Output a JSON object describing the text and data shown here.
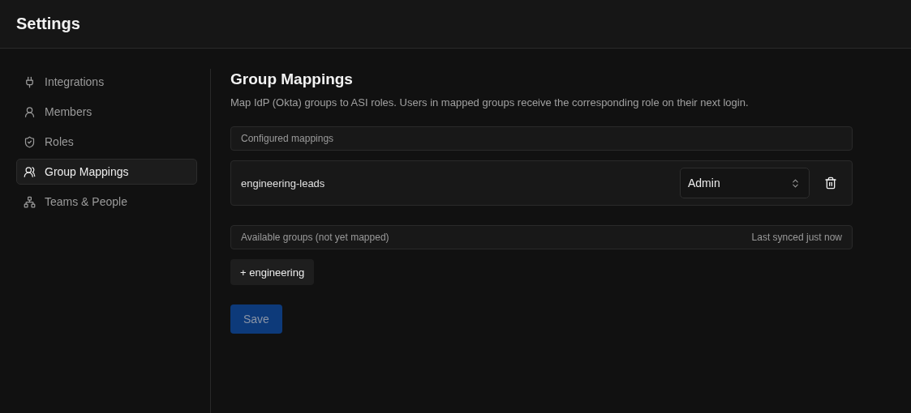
{
  "header": {
    "title": "Settings"
  },
  "sidebar": {
    "items": [
      {
        "label": "Integrations",
        "selected": false
      },
      {
        "label": "Members",
        "selected": false
      },
      {
        "label": "Roles",
        "selected": false
      },
      {
        "label": "Group Mappings",
        "selected": true
      },
      {
        "label": "Teams & People",
        "selected": false
      }
    ]
  },
  "main": {
    "title": "Group Mappings",
    "description": "Map IdP (Okta) groups to ASI roles. Users in mapped groups receive the corresponding role on their next login.",
    "configured": {
      "heading": "Configured mappings",
      "rows": [
        {
          "group": "engineering-leads",
          "role": "Admin"
        }
      ]
    },
    "available": {
      "heading": "Available groups (not yet mapped)",
      "sync_status": "Last synced just now",
      "groups": [
        "+ engineering"
      ]
    },
    "save_button": {
      "label": "Save",
      "disabled": true
    }
  }
}
